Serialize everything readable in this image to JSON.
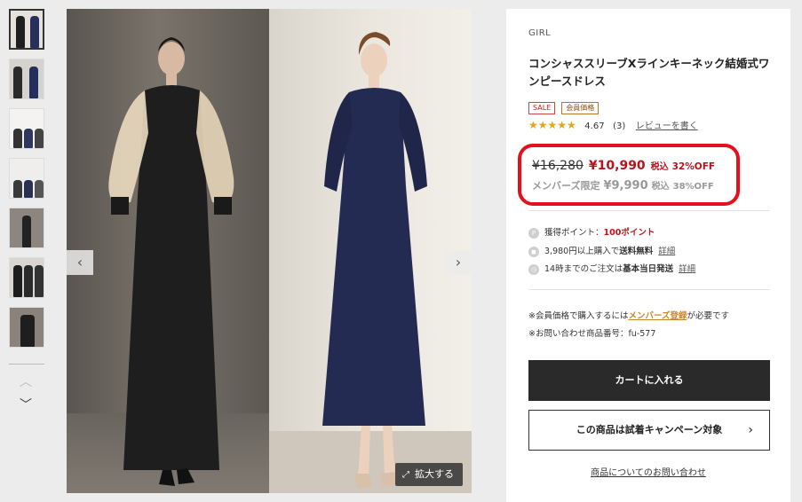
{
  "gallery": {
    "zoom_label": "拡大する",
    "prev_arrow": "‹",
    "next_arrow": "›",
    "thumbnail_count": 7
  },
  "product": {
    "brand": "GIRL",
    "title": "コンシャススリーブXラインキーネック結婚式ワンピースドレス",
    "badges": [
      "SALE",
      "会員価格"
    ],
    "rating": {
      "stars": "★★★★★",
      "score": "4.67",
      "count": "(3)",
      "review_link": "レビューを書く"
    },
    "price": {
      "original": "¥16,280",
      "sale": "¥10,990",
      "tax_label": "税込",
      "discount": "32%OFF",
      "member_label": "メンバーズ限定",
      "member_price": "¥9,990",
      "member_tax_label": "税込",
      "member_discount": "38%OFF"
    },
    "features": {
      "points_label": "獲得ポイント：",
      "points_value": "100ポイント",
      "shipping_prefix": "3,980円以上購入で",
      "shipping_bold": "送料無料",
      "shipping_link": "詳細",
      "sameday_prefix": "14時までのご注文は",
      "sameday_bold": "基本当日発送",
      "sameday_link": "詳細"
    },
    "notes": {
      "member_prefix": "※会員価格で購入するには",
      "member_link": "メンバーズ登録",
      "member_suffix": "が必要です",
      "item_number": "※お問い合わせ商品番号：fu-577"
    },
    "buttons": {
      "cart": "カートに入れる",
      "campaign": "この商品は試着キャンペーン対象",
      "inquiry": "商品についてのお問い合わせ"
    }
  },
  "colors": {
    "accent_red": "#e2111c",
    "price_red": "#b8121c",
    "star": "#e8a317",
    "dark_button": "#2a2a2a",
    "member_gold": "#c8882a"
  }
}
